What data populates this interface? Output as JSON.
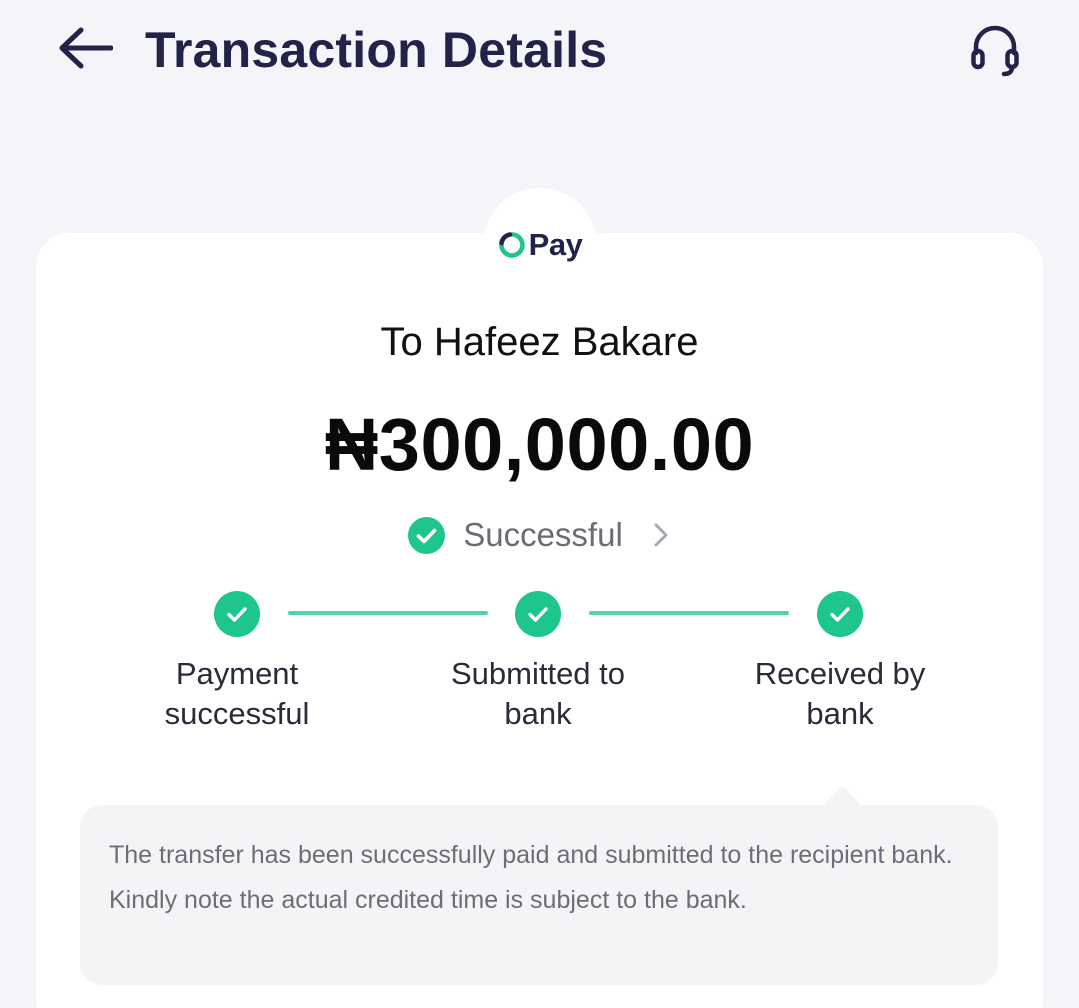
{
  "header": {
    "title": "Transaction Details",
    "back_icon": "back-arrow-icon",
    "support_icon": "headset-icon"
  },
  "brand": {
    "logo_text": "Pay",
    "logo_icon": "opay-ring-icon",
    "brand_color": "#1ec58c",
    "navy": "#23234a"
  },
  "transaction": {
    "recipient": "To Hafeez Bakare",
    "amount": "₦300,000.00",
    "status": "Successful",
    "status_icon": "check-circle-icon",
    "chevron_icon": "chevron-right-icon"
  },
  "steps": [
    {
      "line1": "Payment",
      "line2": "successful",
      "icon": "check-icon"
    },
    {
      "line1": "Submitted to",
      "line2": "bank",
      "icon": "check-icon"
    },
    {
      "line1": "Received by",
      "line2": "bank",
      "icon": "check-icon"
    }
  ],
  "note": {
    "text": "The transfer has been successfully paid and submitted to the recipient bank. Kindly note the actual credited time is subject to the bank."
  }
}
